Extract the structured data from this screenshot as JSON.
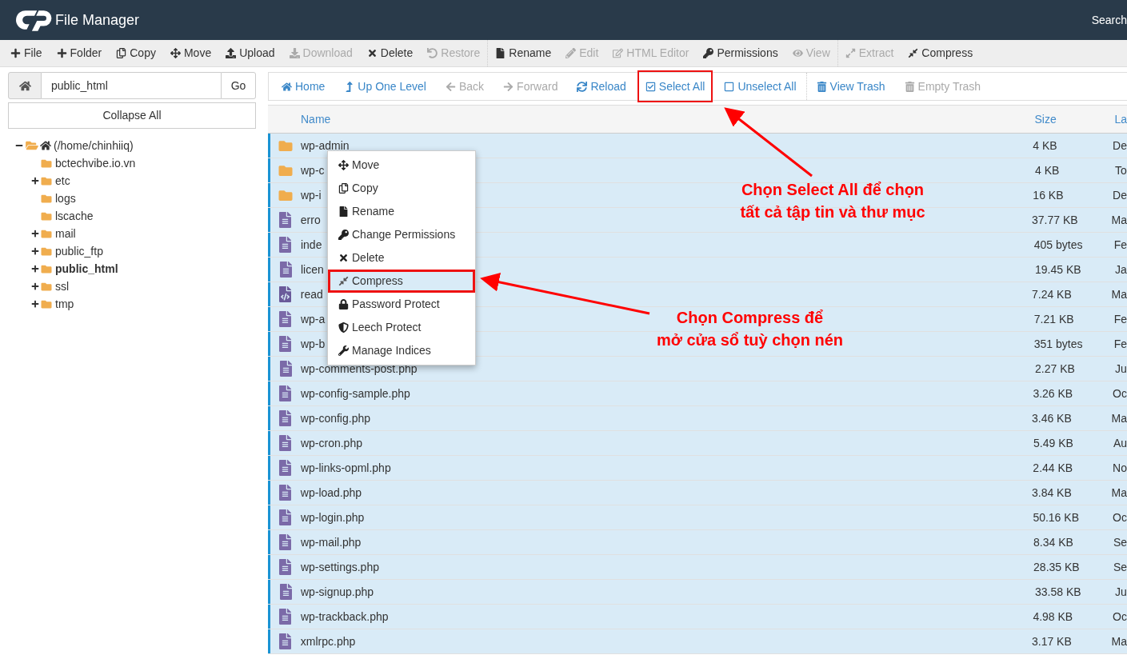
{
  "header": {
    "title": "File Manager",
    "search_label": "Search"
  },
  "toolbar": [
    {
      "label": "File",
      "disabled": false
    },
    {
      "label": "Folder",
      "disabled": false
    },
    {
      "label": "Copy",
      "disabled": false
    },
    {
      "label": "Move",
      "disabled": false
    },
    {
      "label": "Upload",
      "disabled": false
    },
    {
      "label": "Download",
      "disabled": true
    },
    {
      "label": "Delete",
      "disabled": false
    },
    {
      "label": "Restore",
      "disabled": true
    },
    {
      "label": "Rename",
      "disabled": false
    },
    {
      "label": "Edit",
      "disabled": true
    },
    {
      "label": "HTML Editor",
      "disabled": true
    },
    {
      "label": "Permissions",
      "disabled": false
    },
    {
      "label": "View",
      "disabled": true
    },
    {
      "label": "Extract",
      "disabled": true
    },
    {
      "label": "Compress",
      "disabled": false
    }
  ],
  "path_bar": {
    "value": "public_html",
    "button": "Go"
  },
  "collapse_button": "Collapse All",
  "tree": [
    {
      "label": "(/home/chinhiiq)",
      "kind": "home",
      "expanded": true,
      "current": false,
      "children": [
        {
          "label": "bctechvibe.io.vn",
          "expandable": false,
          "current": false
        },
        {
          "label": "etc",
          "expandable": true,
          "current": false
        },
        {
          "label": "logs",
          "expandable": false,
          "current": false
        },
        {
          "label": "lscache",
          "expandable": false,
          "current": false
        },
        {
          "label": "mail",
          "expandable": true,
          "current": false
        },
        {
          "label": "public_ftp",
          "expandable": true,
          "current": false
        },
        {
          "label": "public_html",
          "expandable": true,
          "current": true
        },
        {
          "label": "ssl",
          "expandable": true,
          "current": false
        },
        {
          "label": "tmp",
          "expandable": true,
          "current": false
        }
      ]
    }
  ],
  "nav": [
    {
      "label": "Home",
      "disabled": false,
      "highlighted": false
    },
    {
      "label": "Up One Level",
      "disabled": false,
      "highlighted": false
    },
    {
      "label": "Back",
      "disabled": true,
      "highlighted": false
    },
    {
      "label": "Forward",
      "disabled": true,
      "highlighted": false
    },
    {
      "label": "Reload",
      "disabled": false,
      "highlighted": false
    },
    {
      "label": "Select All",
      "disabled": false,
      "highlighted": true
    },
    {
      "label": "Unselect All",
      "disabled": false,
      "highlighted": false
    },
    {
      "label": "View Trash",
      "disabled": false,
      "highlighted": false
    },
    {
      "label": "Empty Trash",
      "disabled": true,
      "highlighted": false
    }
  ],
  "table": {
    "columns": [
      "Name",
      "Size",
      "La"
    ],
    "rows": [
      {
        "kind": "folder",
        "name": "wp-admin",
        "size": "4 KB",
        "column_3": "De",
        "selected": true
      },
      {
        "kind": "folder",
        "name": "wp-c",
        "size": "4 KB",
        "column_3": "To",
        "selected": true
      },
      {
        "kind": "folder",
        "name": "wp-i",
        "size": "16 KB",
        "column_3": "De",
        "selected": true
      },
      {
        "kind": "file",
        "name": "erro",
        "size": "37.77 KB",
        "column_3": "Ma",
        "selected": true
      },
      {
        "kind": "file",
        "name": "inde",
        "size": "405 bytes",
        "column_3": "Fe",
        "selected": true
      },
      {
        "kind": "file",
        "name": "licen",
        "size": "19.45 KB",
        "column_3": "Ja",
        "selected": true
      },
      {
        "kind": "code",
        "name": "read",
        "size": "7.24 KB",
        "column_3": "Ma",
        "selected": true
      },
      {
        "kind": "file",
        "name": "wp-a",
        "size": "7.21 KB",
        "column_3": "Fe",
        "selected": true
      },
      {
        "kind": "file",
        "name": "wp-b",
        "size": "351 bytes",
        "column_3": "Fe",
        "selected": true
      },
      {
        "kind": "file",
        "name": "wp-comments-post.php",
        "size": "2.27 KB",
        "column_3": "Ju",
        "selected": true
      },
      {
        "kind": "file",
        "name": "wp-config-sample.php",
        "size": "3.26 KB",
        "column_3": "Oc",
        "selected": true
      },
      {
        "kind": "file",
        "name": "wp-config.php",
        "size": "3.46 KB",
        "column_3": "Ma",
        "selected": true
      },
      {
        "kind": "file",
        "name": "wp-cron.php",
        "size": "5.49 KB",
        "column_3": "Au",
        "selected": true
      },
      {
        "kind": "file",
        "name": "wp-links-opml.php",
        "size": "2.44 KB",
        "column_3": "No",
        "selected": true
      },
      {
        "kind": "file",
        "name": "wp-load.php",
        "size": "3.84 KB",
        "column_3": "Ma",
        "selected": true
      },
      {
        "kind": "file",
        "name": "wp-login.php",
        "size": "50.16 KB",
        "column_3": "Oc",
        "selected": true
      },
      {
        "kind": "file",
        "name": "wp-mail.php",
        "size": "8.34 KB",
        "column_3": "Se",
        "selected": true
      },
      {
        "kind": "file",
        "name": "wp-settings.php",
        "size": "28.35 KB",
        "column_3": "Se",
        "selected": true
      },
      {
        "kind": "file",
        "name": "wp-signup.php",
        "size": "33.58 KB",
        "column_3": "Ju",
        "selected": true
      },
      {
        "kind": "file",
        "name": "wp-trackback.php",
        "size": "4.98 KB",
        "column_3": "Oc",
        "selected": true
      },
      {
        "kind": "file",
        "name": "xmlrpc.php",
        "size": "3.17 KB",
        "column_3": "Ma",
        "selected": true
      }
    ]
  },
  "context_menu": [
    {
      "label": "Move",
      "selected": false
    },
    {
      "label": "Copy",
      "selected": false
    },
    {
      "label": "Rename",
      "selected": false
    },
    {
      "label": "Change Permissions",
      "selected": false
    },
    {
      "label": "Delete",
      "selected": false
    },
    {
      "label": "Compress",
      "selected": true
    },
    {
      "label": "Password Protect",
      "selected": false
    },
    {
      "label": "Leech Protect",
      "selected": false
    },
    {
      "label": "Manage Indices",
      "selected": false
    }
  ],
  "annotations": [
    {
      "lines": [
        "Chọn Select All để chọn",
        "tất cả tập tin và thư mục"
      ]
    },
    {
      "lines": [
        "Chọn Compress để",
        "mở cửa sổ tuỳ chọn nén"
      ]
    }
  ]
}
